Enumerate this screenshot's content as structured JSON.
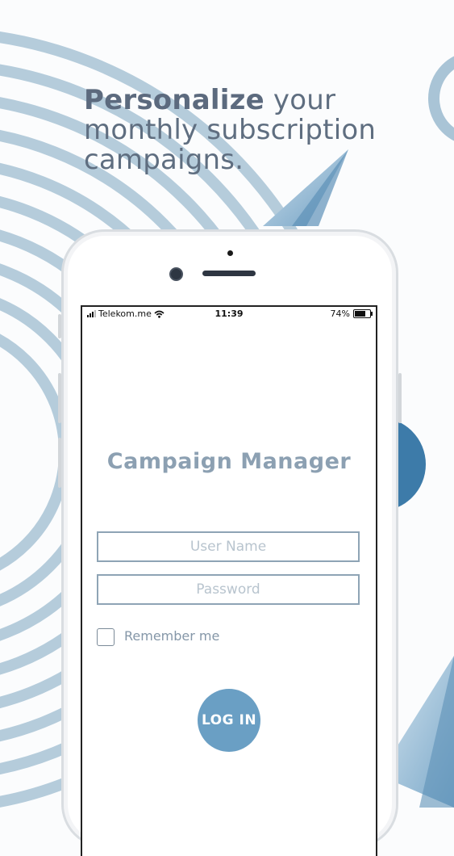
{
  "promo": {
    "headline_bold": "Personalize",
    "headline_line1_rest": " your",
    "headline_line2": "monthly subscription",
    "headline_line3": "campaigns."
  },
  "status_bar": {
    "carrier": "Telekom.me",
    "time": "11:39",
    "battery": "74%",
    "battery_level": 0.74
  },
  "login_screen": {
    "title": "Campaign Manager",
    "username_placeholder": "User Name",
    "password_placeholder": "Password",
    "remember_label": "Remember me",
    "remember_checked": false,
    "login_button": "LOG IN"
  },
  "colors": {
    "accent": "#6a9fc4",
    "title_text": "#8ca0b2",
    "headline_text": "#5f6e80"
  },
  "icons": [
    "signal-icon",
    "wifi-icon",
    "battery-icon",
    "camera-icon",
    "speaker-icon"
  ]
}
